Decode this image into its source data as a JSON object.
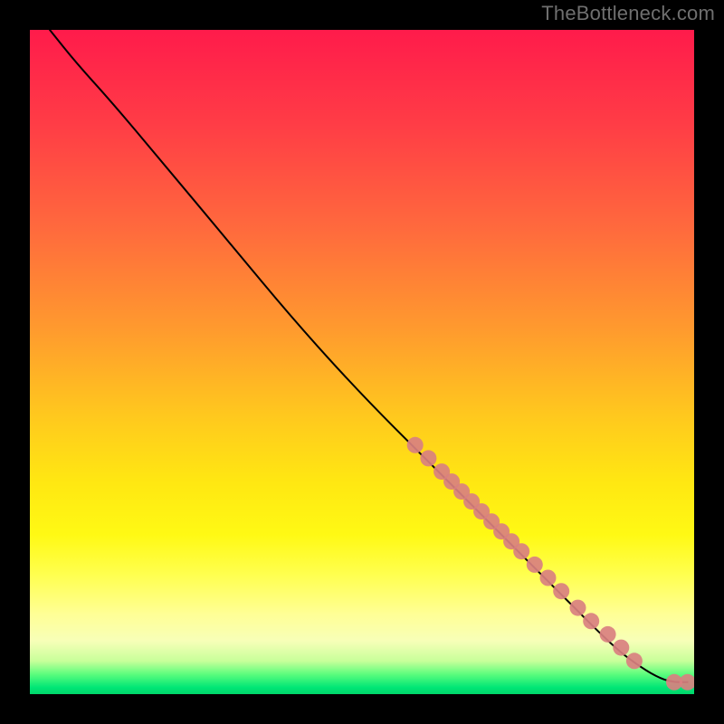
{
  "watermark": "TheBottleneck.com",
  "colors": {
    "dot": "#d98080",
    "curve": "#000000"
  },
  "chart_data": {
    "type": "scatter",
    "title": "",
    "xlabel": "",
    "ylabel": "",
    "xlim": [
      0,
      100
    ],
    "ylim": [
      0,
      100
    ],
    "grid": false,
    "curve": [
      {
        "x": 3,
        "y": 100
      },
      {
        "x": 7,
        "y": 95
      },
      {
        "x": 12,
        "y": 89.5
      },
      {
        "x": 20,
        "y": 80
      },
      {
        "x": 30,
        "y": 68
      },
      {
        "x": 40,
        "y": 56
      },
      {
        "x": 50,
        "y": 45
      },
      {
        "x": 60,
        "y": 35
      },
      {
        "x": 70,
        "y": 25
      },
      {
        "x": 80,
        "y": 15
      },
      {
        "x": 88,
        "y": 7
      },
      {
        "x": 92,
        "y": 4
      },
      {
        "x": 95,
        "y": 2.3
      },
      {
        "x": 97,
        "y": 1.8
      },
      {
        "x": 99,
        "y": 1.8
      }
    ],
    "series": [
      {
        "name": "points",
        "data": [
          {
            "x": 58,
            "y": 37.5
          },
          {
            "x": 60,
            "y": 35.5
          },
          {
            "x": 62,
            "y": 33.5
          },
          {
            "x": 63.5,
            "y": 32
          },
          {
            "x": 65,
            "y": 30.5
          },
          {
            "x": 66.5,
            "y": 29
          },
          {
            "x": 68,
            "y": 27.5
          },
          {
            "x": 69.5,
            "y": 26
          },
          {
            "x": 71,
            "y": 24.5
          },
          {
            "x": 72.5,
            "y": 23
          },
          {
            "x": 74,
            "y": 21.5
          },
          {
            "x": 76,
            "y": 19.5
          },
          {
            "x": 78,
            "y": 17.5
          },
          {
            "x": 80,
            "y": 15.5
          },
          {
            "x": 82.5,
            "y": 13
          },
          {
            "x": 84.5,
            "y": 11
          },
          {
            "x": 87,
            "y": 9
          },
          {
            "x": 89,
            "y": 7
          },
          {
            "x": 91,
            "y": 5
          },
          {
            "x": 97,
            "y": 1.8
          },
          {
            "x": 99,
            "y": 1.8
          }
        ]
      }
    ]
  }
}
